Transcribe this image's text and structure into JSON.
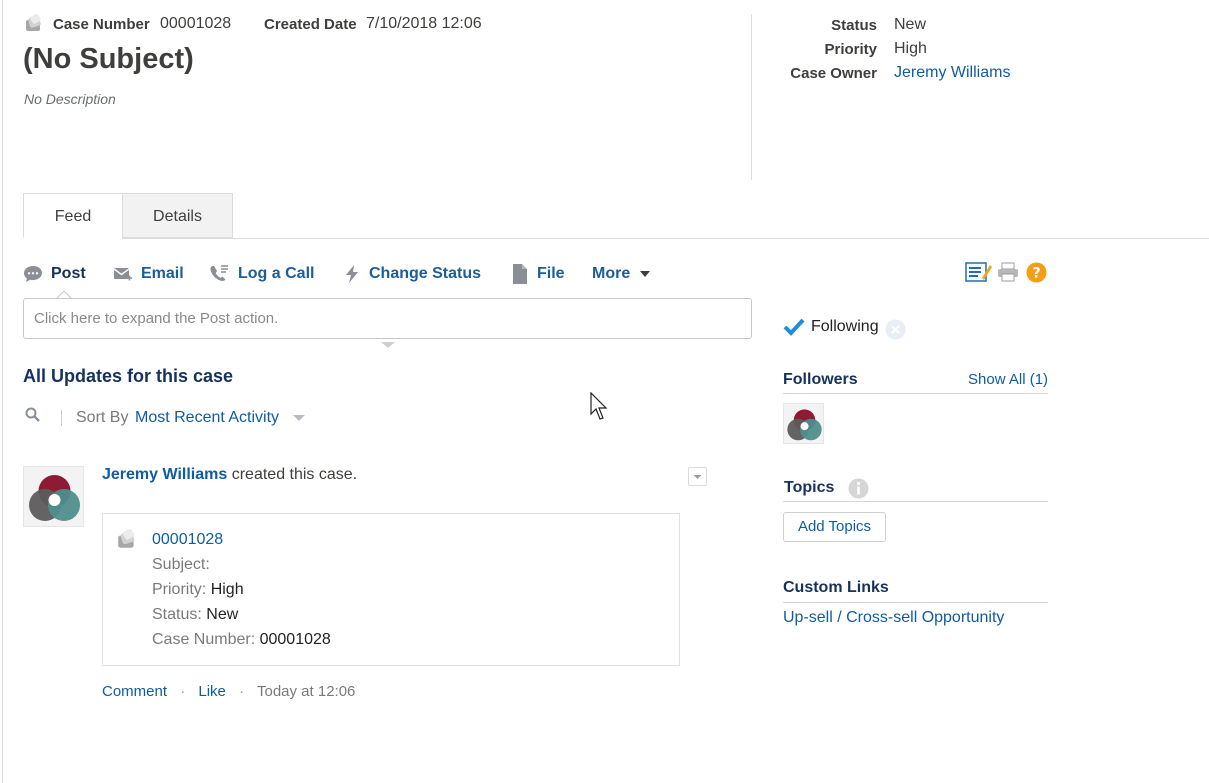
{
  "header": {
    "case_number_label": "Case Number",
    "case_number": "00001028",
    "created_date_label": "Created Date",
    "created_date": "7/10/2018 12:06",
    "title": "(No Subject)",
    "description": "No Description",
    "status_label": "Status",
    "status": "New",
    "priority_label": "Priority",
    "priority": "High",
    "owner_label": "Case Owner",
    "owner": "Jeremy Williams"
  },
  "tabs": [
    {
      "label": "Feed",
      "active": true
    },
    {
      "label": "Details",
      "active": false
    }
  ],
  "actions": {
    "post": "Post",
    "email": "Email",
    "log_call": "Log a Call",
    "change_status": "Change Status",
    "file": "File",
    "more": "More"
  },
  "post_placeholder": "Click here to expand the Post action.",
  "feed": {
    "heading": "All Updates for this case",
    "sort_by_label": "Sort By",
    "sort_value": "Most Recent Activity",
    "item": {
      "author": "Jeremy Williams",
      "action_text": "created this case.",
      "card": {
        "case_link": "00001028",
        "subject_label": "Subject:",
        "subject_value": "",
        "priority_label": "Priority:",
        "priority_value": "High",
        "status_label": "Status:",
        "status_value": "New",
        "case_number_label": "Case Number:",
        "case_number_value": "00001028"
      },
      "comment": "Comment",
      "like": "Like",
      "timestamp": "Today at 12:06"
    }
  },
  "sidebar": {
    "following": "Following",
    "followers_title": "Followers",
    "show_all": "Show All (1)",
    "topics_title": "Topics",
    "add_topics": "Add Topics",
    "custom_links_title": "Custom Links",
    "custom_link": "Up-sell / Cross-sell Opportunity"
  },
  "icons": {
    "case": "case-icon",
    "chat": "chat-bubble-icon",
    "email": "envelope-icon",
    "call": "phone-icon",
    "status": "lightning-icon",
    "file": "file-icon",
    "more": "caret-down-icon",
    "edit_layout": "edit-layout-icon",
    "print": "printer-icon",
    "help": "help-icon",
    "check": "checkmark-icon",
    "unfollow": "close-circle-icon",
    "search": "search-icon",
    "info": "info-icon"
  },
  "colors": {
    "link": "#0f5ca3",
    "text_dark": "#3e3e3c",
    "follow_check": "#1e8fd6",
    "help": "#f49e15",
    "avatar_red": "#8e1b34",
    "avatar_teal": "#4e8e8c",
    "avatar_gray": "#5c5c5c"
  }
}
